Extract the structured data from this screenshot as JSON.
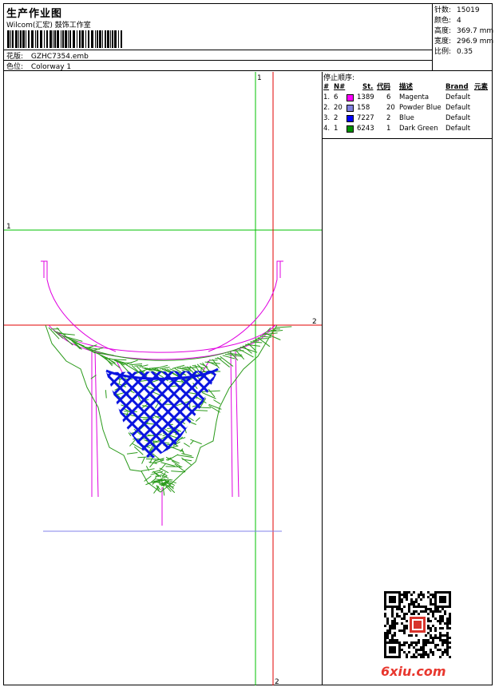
{
  "header": {
    "title": "生产作业图",
    "studio": "Wilcom(汇宏) 鼓饰工作室",
    "design_label": "花版:",
    "design_file": "GZHC7354.emb",
    "colorway_label": "色位:",
    "colorway": "Colorway 1"
  },
  "specs": [
    {
      "label": "针数:",
      "value": "15019"
    },
    {
      "label": "颜色:",
      "value": "4"
    },
    {
      "label": "高度:",
      "value": "369.7 mm"
    },
    {
      "label": "宽度:",
      "value": "296.9 mm"
    },
    {
      "label": "比例:",
      "value": "0.35"
    }
  ],
  "stop_sequence": {
    "title": "停止顺序:",
    "columns": [
      "#",
      "N#",
      "St.",
      "代码",
      "描述",
      "Brand",
      "元素"
    ],
    "rows": [
      {
        "idx": "1.",
        "n": "6",
        "color": "#ff00ff",
        "st": "1389",
        "code": "6",
        "desc": "Magenta",
        "brand": "Default"
      },
      {
        "idx": "2.",
        "n": "20",
        "color": "#8080e0",
        "st": "158",
        "code": "20",
        "desc": "Powder Blue",
        "brand": "Default"
      },
      {
        "idx": "3.",
        "n": "2",
        "color": "#0000ff",
        "st": "7227",
        "code": "2",
        "desc": "Blue",
        "brand": "Default"
      },
      {
        "idx": "4.",
        "n": "1",
        "color": "#009000",
        "st": "6243",
        "code": "1",
        "desc": "Dark Green",
        "brand": "Default"
      }
    ]
  },
  "guides": {
    "green_vertical_label": "1",
    "green_horizontal_label": "1",
    "red_horizontal_label": "2",
    "red_vertical_label": "2"
  },
  "colors": {
    "magenta": "#e000e0",
    "green": "#2a9a1a",
    "blue": "#0a14e0",
    "powder_blue": "#8080e8",
    "guide_green": "#00c000",
    "guide_red": "#e00000"
  },
  "watermark": {
    "site": "6xiu.com",
    "stamp_icon": "qr-code-icon"
  }
}
